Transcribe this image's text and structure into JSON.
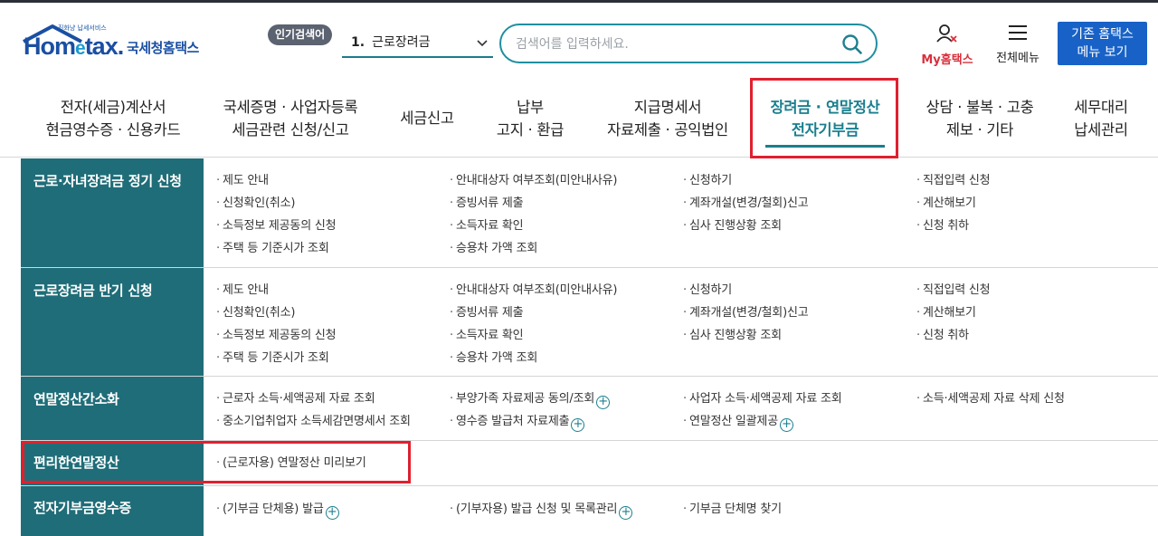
{
  "header": {
    "logo": {
      "text": "Hometax.",
      "subtitle": "국세청홈택스",
      "tagline": "진화냥 납세서비스"
    },
    "popular_badge": "인기검색어",
    "popular_select": {
      "rank": "1.",
      "value": "근로장려금"
    },
    "search": {
      "placeholder": "검색어를 입력하세요."
    },
    "my_hometax": "My홈택스",
    "all_menu": "전체메뉴",
    "old_home": {
      "line1": "기존 홈택스",
      "line2": "메뉴 보기"
    }
  },
  "nav": {
    "items": [
      {
        "line1": "전자(세금)계산서",
        "line2": "현금영수증 · 신용카드"
      },
      {
        "line1": "국세증명 · 사업자등록",
        "line2": "세금관련 신청/신고"
      },
      {
        "line1": "세금신고",
        "line2": ""
      },
      {
        "line1": "납부",
        "line2": "고지 · 환급"
      },
      {
        "line1": "지급명세서",
        "line2": "자료제출 · 공익법인"
      },
      {
        "line1": "장려금 · 연말정산",
        "line2": "전자기부금"
      },
      {
        "line1": "상담 · 불복 · 고충",
        "line2": "제보 · 기타"
      },
      {
        "line1": "세무대리",
        "line2": "납세관리"
      }
    ]
  },
  "menu": {
    "rows": [
      {
        "title": "근로·자녀장려금 정기 신청",
        "items": [
          "제도 안내",
          "안내대상자 여부조회(미안내사유)",
          "신청하기",
          "직접입력 신청",
          "신청확인(취소)",
          "증빙서류 제출",
          "계좌개설(변경/철회)신고",
          "계산해보기",
          "소득정보 제공동의 신청",
          "소득자료 확인",
          "심사 진행상황 조회",
          "신청 취하",
          "주택 등 기준시가 조회",
          "승용차 가액 조회"
        ]
      },
      {
        "title": "근로장려금 반기 신청",
        "items": [
          "제도 안내",
          "안내대상자 여부조회(미안내사유)",
          "신청하기",
          "직접입력 신청",
          "신청확인(취소)",
          "증빙서류 제출",
          "계좌개설(변경/철회)신고",
          "계산해보기",
          "소득정보 제공동의 신청",
          "소득자료 확인",
          "심사 진행상황 조회",
          "신청 취하",
          "주택 등 기준시가 조회",
          "승용차 가액 조회"
        ]
      },
      {
        "title": "연말정산간소화",
        "items": [
          "근로자 소득·세액공제 자료 조회",
          "부양가족 자료제공 동의/조회",
          "사업자 소득·세액공제 자료 조회",
          "소득·세액공제 자료 삭제 신청",
          "중소기업취업자 소득세감면명세서 조회",
          "영수증 발급처 자료제출",
          "연말정산 일괄제공"
        ]
      },
      {
        "title": "편리한연말정산",
        "items": [
          "(근로자용) 연말정산 미리보기"
        ]
      },
      {
        "title": "전자기부금영수증",
        "items": [
          "(기부금 단체용) 발급",
          "(기부자용) 발급 신청 및 목록관리",
          "기부금 단체명 찾기"
        ]
      }
    ]
  }
}
